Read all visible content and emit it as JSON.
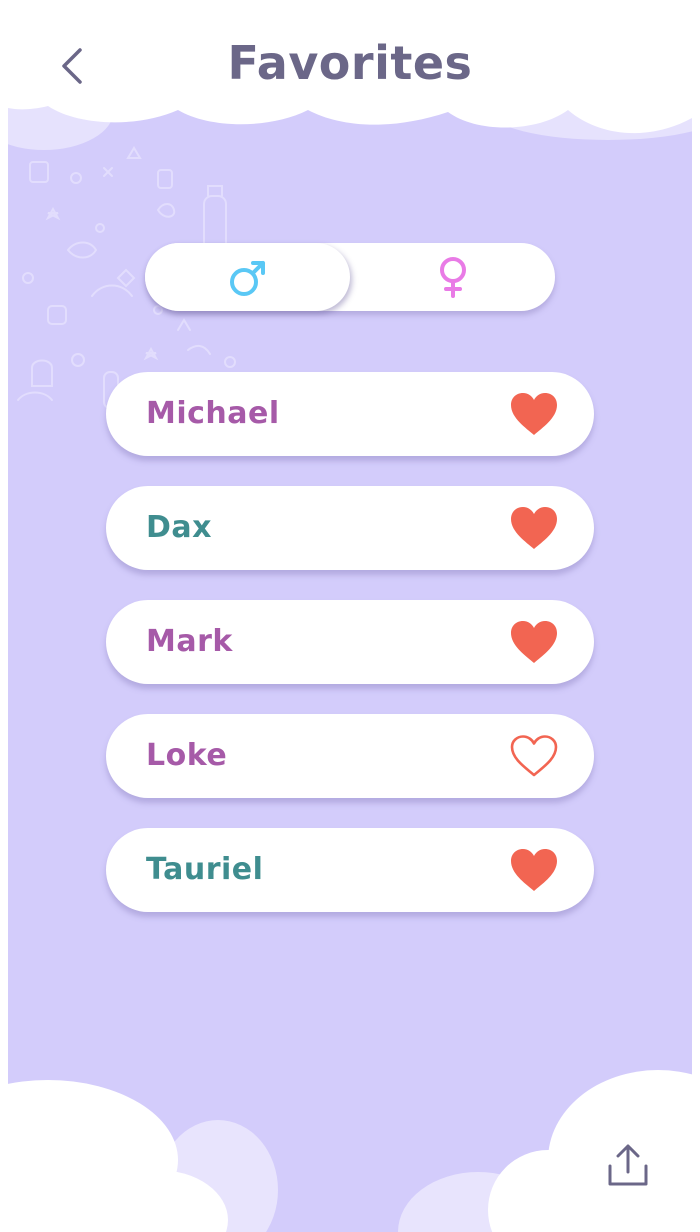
{
  "header": {
    "title": "Favorites",
    "back_icon": "chevron-left-icon"
  },
  "gender_toggle": {
    "selected": "male",
    "male_icon": "male-symbol-icon",
    "female_icon": "female-symbol-icon",
    "male_color": "#5ac8f5",
    "female_color": "#e97be6"
  },
  "favorites": [
    {
      "name": "Michael",
      "color": "#a65aa8",
      "favorited": true
    },
    {
      "name": "Dax",
      "color": "#3f8d8f",
      "favorited": true
    },
    {
      "name": "Mark",
      "color": "#a65aa8",
      "favorited": true
    },
    {
      "name": "Loke",
      "color": "#a65aa8",
      "favorited": false
    },
    {
      "name": "Tauriel",
      "color": "#3f8d8f",
      "favorited": true
    }
  ],
  "colors": {
    "background": "#d3ccfb",
    "title": "#6b6788",
    "heart": "#f26552",
    "icon": "#6b6788"
  },
  "footer": {
    "share_icon": "share-upload-icon"
  }
}
